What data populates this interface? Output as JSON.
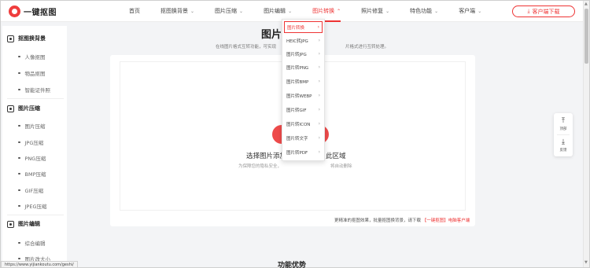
{
  "header": {
    "logo_text": "一键抠图",
    "nav": [
      {
        "label": "首页",
        "has_dropdown": false
      },
      {
        "label": "抠图换背景",
        "has_dropdown": true
      },
      {
        "label": "图片压缩",
        "has_dropdown": true
      },
      {
        "label": "图片编辑",
        "has_dropdown": true
      },
      {
        "label": "图片转换",
        "has_dropdown": true,
        "active": true
      },
      {
        "label": "照片修复",
        "has_dropdown": true
      },
      {
        "label": "特色功能",
        "has_dropdown": true
      },
      {
        "label": "客户端",
        "has_dropdown": true
      }
    ],
    "download_label": "客户端下载",
    "download_icon": "download-icon"
  },
  "sidebar": {
    "sections": [
      {
        "title": "抠图换背景",
        "icon": "image-icon",
        "items": [
          "人像抠图",
          "物品抠图",
          "智能证件照"
        ]
      },
      {
        "title": "图片压缩",
        "icon": "compress-icon",
        "items": [
          "图片压缩",
          "JPG压缩",
          "PNG压缩",
          "BMP压缩",
          "GIF压缩",
          "JPEG压缩"
        ]
      },
      {
        "title": "图片编辑",
        "icon": "edit-icon",
        "items": [
          "综合编辑",
          "图片改大小"
        ]
      }
    ]
  },
  "main": {
    "title": "图片格",
    "subtitle_left": "在线图片格式互转功能，可实现",
    "subtitle_right": "片格式进行互转处理。",
    "upload_plus": "+",
    "upload_main_left": "选择图片添加",
    "upload_main_right": "此区域",
    "upload_sub_left": "为保障您的隐私安全，",
    "upload_sub_right": "将自动删除",
    "client_note_text": "更精准的抠图效果，批量抠图换背景，请下载",
    "client_note_link": "【一键抠图】电脑客户端",
    "features_title": "功能优势"
  },
  "dropdown": {
    "items": [
      {
        "label": "图片转换",
        "active": true
      },
      {
        "label": "HEIC转JPG"
      },
      {
        "label": "图片转JPG"
      },
      {
        "label": "图片转PNG"
      },
      {
        "label": "图片转BMP"
      },
      {
        "label": "图片转WEBP"
      },
      {
        "label": "图片转GIF"
      },
      {
        "label": "图片转ICON"
      },
      {
        "label": "图片转文字"
      },
      {
        "label": "图片转PDF"
      }
    ]
  },
  "float_tools": {
    "top_label": "顶部",
    "feedback_label": "反馈"
  },
  "status_url": "https://www.yijiankoutu.com/geshi/",
  "colors": {
    "accent": "#e33333",
    "upload_button": "#ee4b4b"
  }
}
